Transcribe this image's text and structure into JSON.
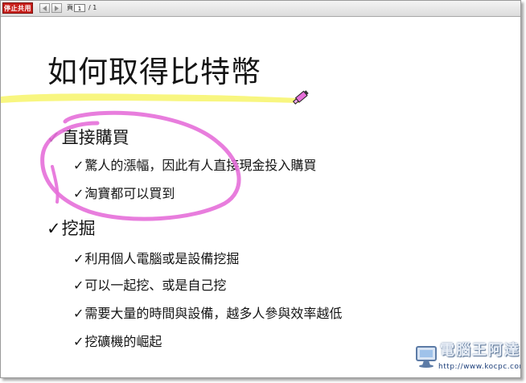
{
  "toolbar": {
    "stop_button_label": "停止共用",
    "page_prefix": "頁",
    "page_current": "1",
    "page_total": "/ 1"
  },
  "slide": {
    "title": "如何取得比特幣",
    "check_mark": "✓",
    "bullets": [
      {
        "level": 1,
        "text": "直接購買"
      },
      {
        "level": 2,
        "text": "驚人的漲幅，因此有人直接現金投入購買"
      },
      {
        "level": 2,
        "text": "淘寶都可以買到"
      },
      {
        "level": 1,
        "text": "挖掘"
      },
      {
        "level": 2,
        "text": "利用個人電腦或是設備挖掘"
      },
      {
        "level": 2,
        "text": "可以一起挖、或是自己挖"
      },
      {
        "level": 2,
        "text": "需要大量的時間與設備，越多人參與效率越低"
      },
      {
        "level": 2,
        "text": "挖礦機的崛起"
      }
    ]
  },
  "annotations": {
    "highlight_color": "#f7f46a",
    "circle_color": "#e66fd9",
    "highlighter_icon": "highlighter-pen-icon"
  },
  "watermark": {
    "name": "電腦王阿達",
    "url": "http://www.kocpc.com.tw",
    "logo_icon": "computer-monitor-logo-icon"
  }
}
